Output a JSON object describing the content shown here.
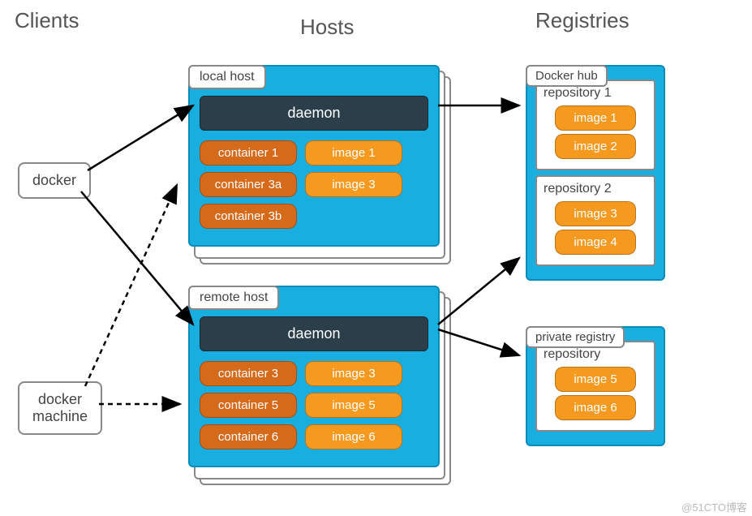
{
  "headers": {
    "clients": "Clients",
    "hosts": "Hosts",
    "registries": "Registries"
  },
  "clients": {
    "docker": "docker",
    "docker_machine": "docker\nmachine"
  },
  "hosts": {
    "local": {
      "title": "local host",
      "daemon": "daemon",
      "rows": [
        {
          "container": "container 1",
          "image": "image 1"
        },
        {
          "container": "container 3a",
          "image": "image 3"
        },
        {
          "container": "container 3b",
          "image": ""
        }
      ]
    },
    "remote": {
      "title": "remote host",
      "daemon": "daemon",
      "rows": [
        {
          "container": "container 3",
          "image": "image 3"
        },
        {
          "container": "container 5",
          "image": "image 5"
        },
        {
          "container": "container 6",
          "image": "image 6"
        }
      ]
    }
  },
  "registries": {
    "docker_hub": {
      "title": "Docker hub",
      "repos": [
        {
          "label": "repository 1",
          "images": [
            "image 1",
            "image 2"
          ]
        },
        {
          "label": "repository 2",
          "images": [
            "image 3",
            "image 4"
          ]
        }
      ]
    },
    "private": {
      "title": "private registry",
      "repos": [
        {
          "label": "repository",
          "images": [
            "image 5",
            "image 6"
          ]
        }
      ]
    }
  },
  "watermark": "@51CTO博客"
}
